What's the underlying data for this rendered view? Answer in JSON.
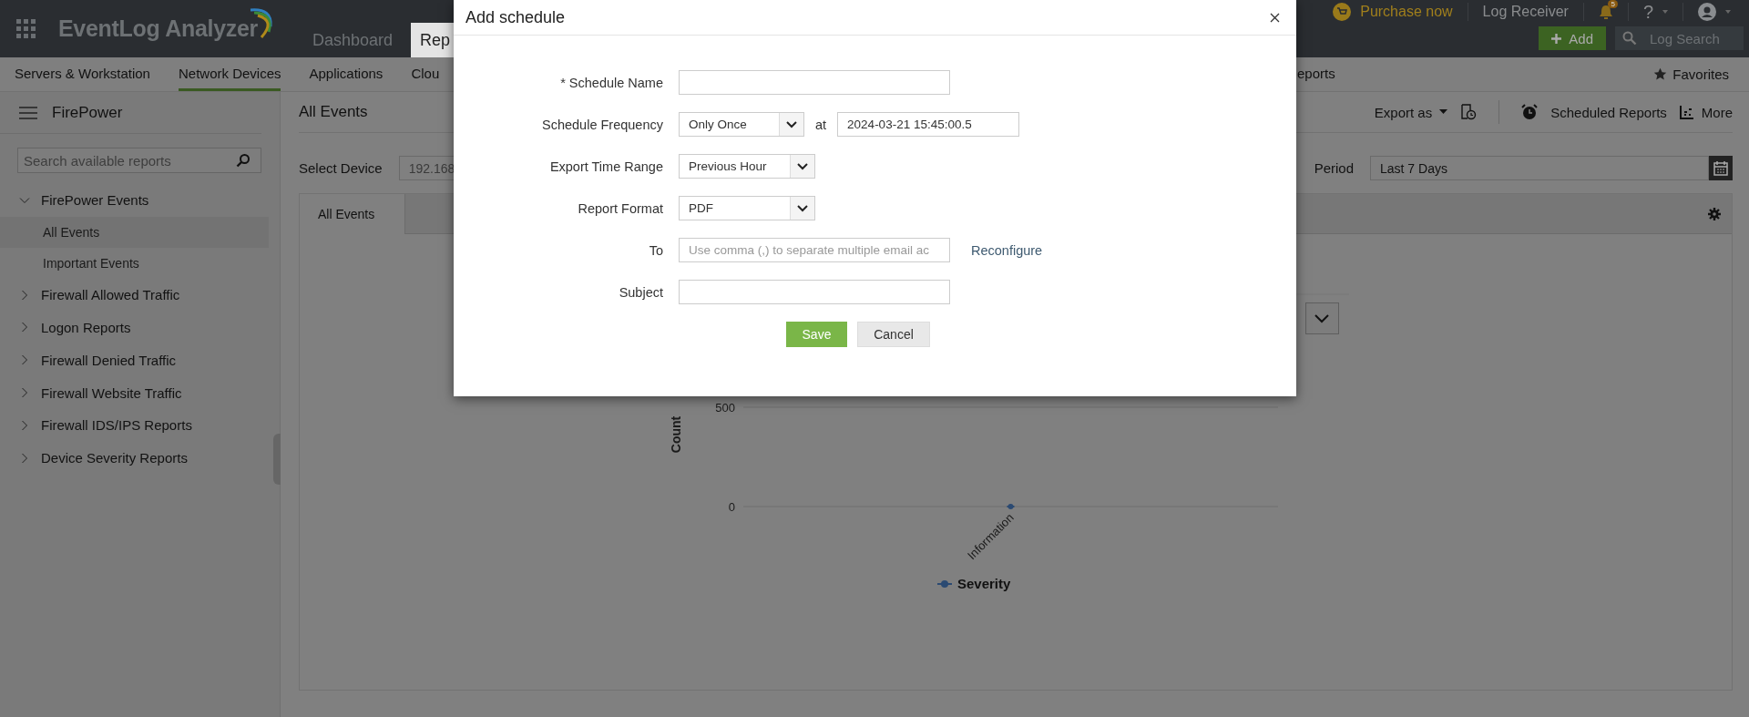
{
  "app": {
    "title": "EventLog Analyzer",
    "tabs": [
      {
        "label": "Dashboard",
        "selected": false
      },
      {
        "label": "Rep",
        "selected": true
      }
    ],
    "purchase": "Purchase now",
    "log_receiver": "Log Receiver",
    "notifications": "5",
    "help": "?",
    "add_button": "Add",
    "log_search": "Log Search"
  },
  "subnav": {
    "items": [
      {
        "label": "Servers & Workstation",
        "selected": false
      },
      {
        "label": "Network Devices",
        "selected": true
      },
      {
        "label": "Applications",
        "selected": false
      },
      {
        "label": "Clou",
        "selected": false
      }
    ],
    "right_item": "eports",
    "favorites": "Favorites"
  },
  "sidebar": {
    "title": "FirePower",
    "search": {
      "placeholder": "Search available reports"
    },
    "items": [
      {
        "label": "FirePower Events",
        "expanded": true,
        "children": [
          {
            "label": "All Events",
            "selected": true
          },
          {
            "label": "Important Events",
            "selected": false
          }
        ]
      },
      {
        "label": "Firewall Allowed Traffic",
        "expanded": false
      },
      {
        "label": "Logon Reports",
        "expanded": false
      },
      {
        "label": "Firewall Denied Traffic",
        "expanded": false
      },
      {
        "label": "Firewall Website Traffic",
        "expanded": false
      },
      {
        "label": "Firewall IDS/IPS Reports",
        "expanded": false
      },
      {
        "label": "Device Severity Reports",
        "expanded": false
      }
    ]
  },
  "main": {
    "title": "All Events",
    "export_as": "Export as",
    "scheduled_reports": "Scheduled Reports",
    "more": "More",
    "select_device_label": "Select Device",
    "select_device_value": "192.168",
    "period_label": "Period",
    "period_value": "Last 7 Days",
    "panel_tabs": [
      {
        "label": "All Events",
        "selected": true
      }
    ],
    "chart_data": {
      "type": "line",
      "ylabel": "Count",
      "categories": [
        "Information"
      ],
      "ylim": [
        0,
        500
      ],
      "yticks": [
        0,
        500
      ],
      "series": [
        {
          "name": "Severity",
          "color": "#2b4a72",
          "marker": "circle",
          "values": [
            0
          ]
        }
      ]
    }
  },
  "modal": {
    "title": "Add schedule",
    "fields": [
      {
        "kind": "text",
        "label": "* Schedule Name"
      },
      {
        "kind": "select_time",
        "label": "Schedule Frequency",
        "value": "Only Once",
        "at": "at",
        "time": "2024-03-21 15:45:00.5"
      },
      {
        "kind": "select",
        "label": "Export Time Range",
        "value": "Previous Hour"
      },
      {
        "kind": "select",
        "label": "Report Format",
        "value": "PDF"
      },
      {
        "kind": "email",
        "label": "To",
        "placeholder": "Use comma (,) to separate multiple email ac",
        "link": "Reconfigure"
      },
      {
        "kind": "text",
        "label": "Subject"
      }
    ],
    "save": "Save",
    "cancel": "Cancel"
  }
}
